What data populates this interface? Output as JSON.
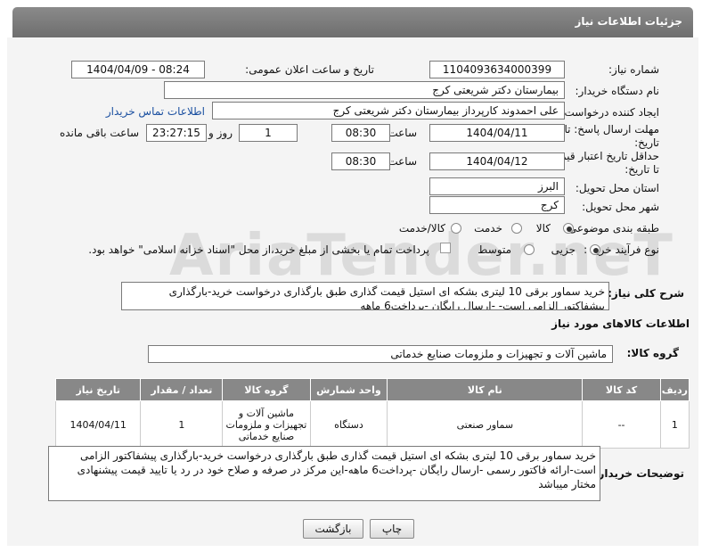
{
  "header": {
    "title": "جزئیات اطلاعات نیاز"
  },
  "form": {
    "need_number_label": "شماره نیاز:",
    "need_number": "1104093634000399",
    "announce_label": "تاریخ و ساعت اعلان عمومی:",
    "announce_value": "1404/04/09 - 08:24",
    "buyer_label": "نام دستگاه خریدار:",
    "buyer": "بیمارستان دکتر شریعتی کرج",
    "creator_label": "ایجاد کننده درخواست:",
    "creator": "علی احمدوند کارپرداز بیمارستان دکتر شریعتی کرج",
    "contact_link": "اطلاعات تماس خریدار",
    "deadline_label_1": "مهلت ارسال پاسخ: تا",
    "deadline_label_2": "تاریخ:",
    "deadline_date": "1404/04/11",
    "time_label": "ساعت",
    "deadline_time": "08:30",
    "days_value": "1",
    "days_label": "روز و",
    "remaining_time": "23:27:15",
    "remaining_label": "ساعت باقی مانده",
    "validity_label_1": "حداقل تاریخ اعتبار قیمت:",
    "validity_label_2": "تا تاریخ:",
    "validity_date": "1404/04/12",
    "validity_time": "08:30",
    "province_label": "استان محل تحویل:",
    "province": "البرز",
    "city_label": "شهر محل تحویل:",
    "city": "کرج",
    "category_label": "طبقه بندی موضوعی:",
    "category_options": [
      "کالا",
      "خدمت",
      "کالا/خدمت"
    ],
    "process_label": "نوع فرآیند خرید :",
    "process_options": [
      "جزیی",
      "متوسط"
    ],
    "payment_note": "پرداخت تمام یا بخشی از مبلغ خرید،از محل \"اسناد خزانه اسلامی\" خواهد بود."
  },
  "description": {
    "label": "شرح کلی نیاز:",
    "text": "خرید سماور برقی 10 لیتری بشکه ای استیل   قیمت گذاری طبق بارگذاری درخواست خرید-بارگذاری پیشفاکتور الزامی است- -ارسال رایگان -پرداخت6 ماهه"
  },
  "goods": {
    "section_title": "اطلاعات کالاهای مورد نیاز",
    "group_label": "گروه کالا:",
    "group_value": "ماشین آلات و تجهیزات و ملزومات صنایع خدماتی",
    "columns": [
      "ردیف",
      "کد کالا",
      "نام کالا",
      "واحد شمارش",
      "گروه کالا",
      "تعداد / مقدار",
      "تاریخ نیاز"
    ],
    "rows": [
      {
        "row": "1",
        "code": "--",
        "name": "سماور صنعتی",
        "unit": "دستگاه",
        "group": "ماشین آلات و تجهیزات و ملزومات صنایع خدماتی",
        "qty": "1",
        "date": "1404/04/11"
      }
    ]
  },
  "buyer_notes": {
    "label": "توضیحات خریدار:",
    "text": "خرید سماور برقی 10 لیتری بشکه ای استیل   قیمت گذاری طبق بارگذاری درخواست خرید-بارگذاری پیشفاکتور الزامی است-ارائه فاکتور رسمی -ارسال رایگان -پرداخت6 ماهه-این مرکز در صرفه و صلاح خود در رد یا تایید قیمت پیشنهادی مختار میباشد"
  },
  "buttons": {
    "print": "چاپ",
    "back": "بازگشت"
  },
  "watermark": "AriaTender.neT"
}
